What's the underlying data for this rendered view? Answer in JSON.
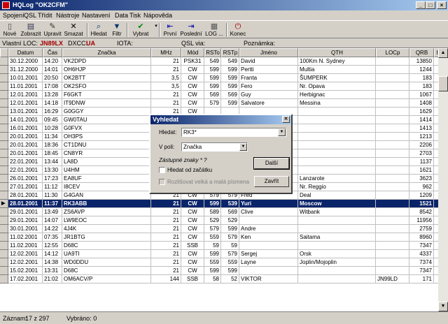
{
  "window": {
    "title": "HQLog \"OK2CFM\"",
    "minimize": "_",
    "maximize": "□",
    "close": "×"
  },
  "menu": [
    "Spojení",
    "QSL",
    "Třídit",
    "Nástroje",
    "Nastavení",
    "Data",
    "Tisk",
    "Nápověda"
  ],
  "toolbar": [
    {
      "label": "Nové",
      "icon": "new-icon",
      "glyph": "▯",
      "color": "#444"
    },
    {
      "label": "Zobrazit",
      "icon": "view-icon",
      "glyph": "▤",
      "color": "#335"
    },
    {
      "label": "Upravit",
      "icon": "edit-icon",
      "glyph": "✎",
      "color": "#333"
    },
    {
      "label": "Smazat",
      "icon": "delete-icon",
      "glyph": "✕",
      "color": "#000"
    },
    {
      "label": "Hledat",
      "icon": "search-icon",
      "glyph": "⌕",
      "color": "#036"
    },
    {
      "label": "Filtr",
      "icon": "filter-icon",
      "glyph": "▼",
      "color": "#036"
    },
    {
      "label": "Vybrat",
      "icon": "select-check-icon",
      "glyph": "✔",
      "color": "#080"
    },
    {
      "label": "První",
      "icon": "first-icon",
      "glyph": "⇤",
      "color": "#00a"
    },
    {
      "label": "Poslední",
      "icon": "last-icon",
      "glyph": "⇥",
      "color": "#00a"
    },
    {
      "label": "LOG ...",
      "icon": "log-icon",
      "glyph": "▦",
      "color": "#555"
    },
    {
      "label": "Konec",
      "icon": "exit-icon",
      "glyph": "⏻",
      "color": "#a00"
    }
  ],
  "info": {
    "loc_label": "Vlastní LOC:",
    "loc_value": "JN89LX",
    "dxcc_label": "DXCC:",
    "dxcc_value": "UA",
    "iota_label": "IOTA:",
    "qslvia_label": "QSL via:",
    "note_label": "Poznámka:"
  },
  "columns": [
    "Datum",
    "Čas",
    "Značka",
    "MHz",
    "Mód",
    "RSTo",
    "RSTp",
    "Jméno",
    "QTH",
    "LOCp",
    "QRB",
    "IOTA",
    "ITU",
    "WAZ",
    "QSLo",
    "QSLp"
  ],
  "rows": [
    [
      "30.12.2000",
      "14:20",
      "VK2DPD",
      "21",
      "PSK31",
      "549",
      "549",
      "David",
      "100Km N. Sydney",
      "",
      "13850",
      "",
      "59",
      "30",
      "B",
      "B"
    ],
    [
      "31.12.2000",
      "14:01",
      "OH6HJP",
      "21",
      "CW",
      "599",
      "599",
      "Pertti",
      "Multia",
      "",
      "1244",
      "",
      "18",
      "15",
      "B",
      "B"
    ],
    [
      "10.01.2001",
      "20:50",
      "OK2BTT",
      "3,5",
      "CW",
      "599",
      "599",
      "Franta",
      "ŠUMPERK",
      "",
      "183",
      "",
      "28",
      "15",
      "B",
      "B"
    ],
    [
      "11.01.2001",
      "17:08",
      "OK2SFO",
      "3,5",
      "CW",
      "599",
      "599",
      "Fero",
      "Nr. Opava",
      "",
      "183",
      "",
      "28",
      "15",
      "B",
      "-"
    ],
    [
      "12.01.2001",
      "13:28",
      "F6GKT",
      "21",
      "CW",
      "569",
      "569",
      "Guy",
      "Herbignac",
      "",
      "1067",
      "",
      "27",
      "14",
      "B",
      "B"
    ],
    [
      "12.01.2001",
      "14:18",
      "IT9DNW",
      "21",
      "CW",
      "579",
      "599",
      "Salvatore",
      "Messina",
      "",
      "1408",
      "",
      "28",
      "15",
      "B",
      "B"
    ],
    [
      "13.01.2001",
      "16:29",
      "G0GGY",
      "21",
      "CW",
      "",
      "",
      "",
      "",
      "",
      "1629",
      "",
      "27",
      "14",
      "B",
      "-"
    ],
    [
      "14.01.2001",
      "09:45",
      "GW0TAU",
      "21",
      "CW",
      "",
      "",
      "",
      "",
      "",
      "1414",
      "",
      "27",
      "14",
      "B",
      "-"
    ],
    [
      "16.01.2001",
      "10:28",
      "G0FVX",
      "21",
      "CW",
      "",
      "",
      "",
      "",
      "",
      "1413",
      "",
      "27",
      "14",
      "B",
      "-"
    ],
    [
      "20.01.2001",
      "11:34",
      "OH3PS",
      "21",
      "CW",
      "",
      "",
      "",
      "",
      "",
      "1213",
      "",
      "18",
      "15",
      "B",
      "-"
    ],
    [
      "20.01.2001",
      "18:36",
      "CT1DNU",
      "21",
      "CW",
      "",
      "",
      "",
      "",
      "",
      "2206",
      "",
      "37",
      "14",
      "B",
      "-"
    ],
    [
      "20.01.2001",
      "18:45",
      "CN8YR",
      "21",
      "CW",
      "",
      "",
      "",
      "",
      "",
      "2703",
      "",
      "37",
      "33",
      "B",
      "-"
    ],
    [
      "22.01.2001",
      "13:44",
      "LA8D",
      "21",
      "CW",
      "",
      "",
      "",
      "",
      "",
      "1137",
      "",
      "18",
      "14",
      "B",
      "-"
    ],
    [
      "22.01.2001",
      "13:30",
      "U4HM",
      "21",
      "CW",
      "",
      "",
      "",
      "",
      "",
      "1621",
      "",
      "18",
      "15",
      "B",
      "-"
    ],
    [
      "26.01.2001",
      "17:23",
      "EA8UF",
      "21",
      "CW",
      "599",
      "",
      "John",
      "Lanzarote",
      "",
      "3623",
      "",
      "36",
      "33",
      "B",
      "B"
    ],
    [
      "27.01.2001",
      "11:12",
      "I8CEV",
      "21",
      "CW",
      "599",
      "599",
      "John",
      "Nr. Reggio",
      "",
      "962",
      "",
      "28",
      "15",
      "B",
      "-"
    ],
    [
      "28.01.2001",
      "11:30",
      "G4GAN",
      "21",
      "CW",
      "579",
      "579",
      "Fred",
      "Deal",
      "",
      "1209",
      "",
      "27",
      "14",
      "B",
      "-"
    ],
    [
      "28.01.2001",
      "11:37",
      "RK3ABB",
      "21",
      "CW",
      "599",
      "539",
      "Yuri",
      "Moscow",
      "",
      "1521",
      "",
      "29",
      "16",
      "B",
      "B"
    ],
    [
      "29.01.2001",
      "13:49",
      "ZS6AVP",
      "21",
      "CW",
      "589",
      "569",
      "Clive",
      "Witbank",
      "",
      "8542",
      "",
      "57",
      "38",
      "B",
      "B"
    ],
    [
      "29.01.2001",
      "14:07",
      "LW9EOC",
      "21",
      "CW",
      "529",
      "529",
      "",
      "",
      "",
      "11956",
      "",
      "14",
      "13",
      "B",
      "B"
    ],
    [
      "30.01.2001",
      "14:22",
      "4J4K",
      "21",
      "CW",
      "579",
      "599",
      "Andre",
      "",
      "",
      "2759",
      "",
      "29",
      "21",
      "B",
      "-"
    ],
    [
      "11.02.2001",
      "07:35",
      "JR1BTG",
      "21",
      "CW",
      "559",
      "579",
      "Ken",
      "Saitama",
      "",
      "8960",
      "",
      "45",
      "25",
      "B",
      "B"
    ],
    [
      "11.02.2001",
      "12:55",
      "D68C",
      "21",
      "SSB",
      "59",
      "59",
      "",
      "",
      "",
      "7347",
      "",
      "53",
      "39",
      "B",
      "B"
    ],
    [
      "12.02.2001",
      "14:12",
      "UA9TI",
      "21",
      "CW",
      "599",
      "579",
      "Sergej",
      "Orsk",
      "",
      "4337",
      "",
      "30",
      "17",
      "B",
      "-"
    ],
    [
      "12.02.2001",
      "14:38",
      "WD0DDU",
      "21",
      "CW",
      "559",
      "559",
      "Layne",
      "Joplin/Mojoplin",
      "",
      "7374",
      "",
      "8",
      "5",
      "B",
      "B"
    ],
    [
      "15.02.2001",
      "13:31",
      "D68C",
      "21",
      "CW",
      "599",
      "599",
      "",
      "",
      "",
      "7347",
      "",
      "53",
      "39",
      "B",
      "B"
    ],
    [
      "17.02.2001",
      "21:02",
      "OM6ACV/P",
      "144",
      "SSB",
      "58",
      "52",
      "VIKTOR",
      "",
      "JN99LD",
      "171",
      "",
      "28",
      "15",
      "B",
      "B"
    ]
  ],
  "selected_row": 17,
  "dialog": {
    "title": "Vyhledat",
    "search_label": "Hledat:",
    "search_value": "RK3*",
    "field_label": "V poli:",
    "field_value": "Značka",
    "wildcards": "Zástupné znaky * ?",
    "from_start_label": "Hledat od začátku",
    "case_label": "Rozlišovat velká a malá písmena",
    "next_button": "Další",
    "close_button": "Zavřít"
  },
  "status": {
    "records_label": "Záznam:",
    "records_value": "17 z  297",
    "selected_label": "Vybráno: 0"
  }
}
